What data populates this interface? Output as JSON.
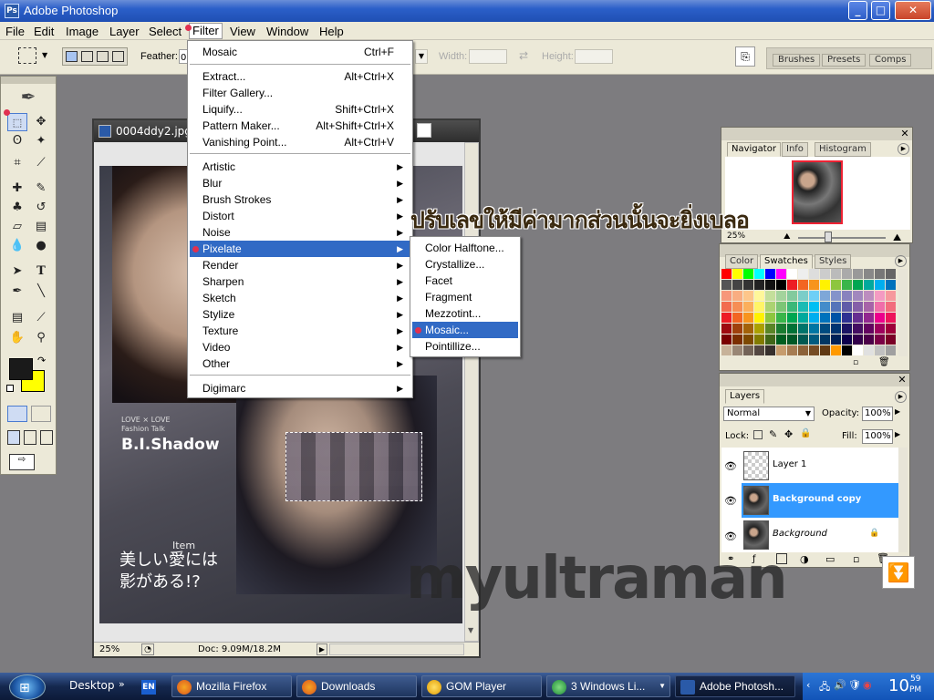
{
  "window": {
    "title": "Adobe Photoshop",
    "controls": [
      "_",
      "□",
      "✕"
    ]
  },
  "menubar": [
    "File",
    "Edit",
    "Image",
    "Layer",
    "Select",
    "Filter",
    "View",
    "Window",
    "Help"
  ],
  "options": {
    "feather_label": "Feather:",
    "feather_value": "0",
    "width_label": "Width:",
    "height_label": "Height:",
    "tabs": [
      "Brushes",
      "Presets",
      "Comps"
    ]
  },
  "filter_menu": {
    "top": [
      {
        "label": "Mosaic",
        "shortcut": "Ctrl+F"
      }
    ],
    "group2": [
      {
        "label": "Extract...",
        "shortcut": "Alt+Ctrl+X"
      },
      {
        "label": "Filter Gallery...",
        "shortcut": ""
      },
      {
        "label": "Liquify...",
        "shortcut": "Shift+Ctrl+X"
      },
      {
        "label": "Pattern Maker...",
        "shortcut": "Alt+Shift+Ctrl+X"
      },
      {
        "label": "Vanishing Point...",
        "shortcut": "Alt+Ctrl+V"
      }
    ],
    "group3": [
      "Artistic",
      "Blur",
      "Brush Strokes",
      "Distort",
      "Noise",
      "Pixelate",
      "Render",
      "Sharpen",
      "Sketch",
      "Stylize",
      "Texture",
      "Video",
      "Other"
    ],
    "group4": [
      "Digimarc"
    ],
    "highlighted": "Pixelate"
  },
  "pixelate_menu": {
    "items": [
      "Color Halftone...",
      "Crystallize...",
      "Facet",
      "Fragment",
      "Mezzotint...",
      "Mosaic...",
      "Pointillize..."
    ],
    "highlighted": "Mosaic..."
  },
  "document": {
    "title": "0004ddy2.jpg",
    "zoom": "25%",
    "doc_size": "Doc: 9.09M/18.2M",
    "image_text": {
      "love": "LOVE × LOVE",
      "talk": "Fashion Talk",
      "brand": "B.I.Shadow",
      "item": "Item",
      "headline1": "美しい愛には",
      "headline2": "影がある!?"
    }
  },
  "overlay_text": "ปรับเลขให้มีค่ามากส่วนนั้นจะยิ่งเบลอ",
  "watermark": "myultraman",
  "navigator": {
    "tabs": [
      "Navigator",
      "Info",
      "Histogram"
    ],
    "zoom": "25%"
  },
  "swatches_panel": {
    "tabs": [
      "Color",
      "Swatches",
      "Styles"
    ]
  },
  "layers_panel": {
    "tab": "Layers",
    "blend_mode": "Normal",
    "opacity_label": "Opacity:",
    "opacity": "100%",
    "lock_label": "Lock:",
    "fill_label": "Fill:",
    "fill": "100%",
    "layers": [
      {
        "name": "Layer 1",
        "selected": false
      },
      {
        "name": "Background copy",
        "selected": true
      },
      {
        "name": "Background",
        "selected": false
      }
    ]
  },
  "taskbar": {
    "lang": "EN",
    "desktop": "Desktop",
    "buttons": [
      "Mozilla Firefox",
      "Downloads",
      "GOM Player",
      "3 Windows Li...",
      "Adobe Photosh..."
    ],
    "clock_hour": "10",
    "clock_min": "59",
    "clock_ampm": "PM"
  },
  "colors": {
    "accent": "#316ac5",
    "selection": "#3399ff",
    "fg_swatch": "#1a1a1a",
    "bg_swatch": "#ffff00"
  }
}
